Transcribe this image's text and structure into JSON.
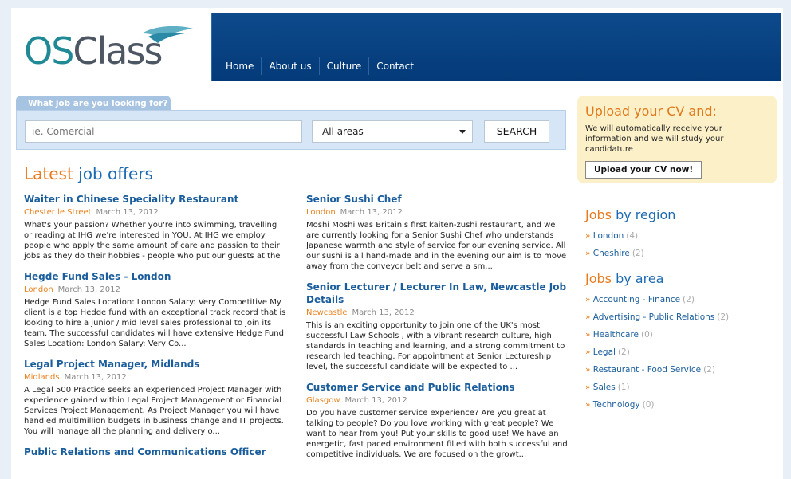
{
  "logo": {
    "text_a": "OS",
    "text_b": "Class"
  },
  "nav": [
    "Home",
    "About us",
    "Culture",
    "Contact"
  ],
  "search": {
    "tab_label": "What job are you looking for?",
    "placeholder": "ie. Comercial",
    "area_selected": "All areas",
    "button": "SEARCH"
  },
  "latest": {
    "word1": "Latest",
    "word2": "job offers"
  },
  "jobs_left": [
    {
      "title": "Waiter in Chinese Speciality Restaurant",
      "location": "Chester le Street",
      "date": "March 13, 2012",
      "desc": "What's your passion? Whether you're into swimming, travelling or reading at IHG we're interested in YOU. At IHG we employ people who apply the same amount of care and passion to their jobs as they do their hobbies - people who put our guests at the"
    },
    {
      "title": "Hegde Fund Sales - London",
      "location": "London",
      "date": "March 13, 2012",
      "desc": "Hedge Fund Sales Location: London Salary: Very Competitive My client is a top Hedge fund with an exceptional track record that is looking to hire a junior / mid level sales professional to join its team. The successful candidates will have extensive Hedge Fund Sales Location: London Salary: Very Co..."
    },
    {
      "title": "Legal Project Manager, Midlands",
      "location": "Midlands",
      "date": "March 13, 2012",
      "desc": "A Legal 500 Practice seeks an experienced Project Manager with experience gained within Legal Project Management or Financial Services Project Management. As Project Manager you will have handled multimillion budgets in business change and IT projects. You will manage all the planning and delivery o..."
    },
    {
      "title": "Public Relations and Communications Officer",
      "location": "",
      "date": "",
      "desc": ""
    }
  ],
  "jobs_right": [
    {
      "title": "Senior Sushi Chef",
      "location": "London",
      "date": "March 13, 2012",
      "desc": "Moshi Moshi was Britain's first kaiten-zushi restaurant, and we are currently looking for a Senior Sushi Chef who understands Japanese warmth and style of service for our evening service. All our sushi is all hand-made and in the evening our aim is to move away from the conveyor belt and serve a sm..."
    },
    {
      "title": "Senior Lecturer / Lecturer In Law, Newcastle Job Details",
      "location": "Newcastle",
      "date": "March 13, 2012",
      "desc": "This is an exciting opportunity to join one of the UK's most successful Law Schools , with a vibrant research culture, high standards in teaching and learning, and a strong commitment to research led teaching. For appointment at Senior Lectureship level, the successful candidate will be expected to ..."
    },
    {
      "title": "Customer Service and Public Relations",
      "location": "Glasgow",
      "date": "March 13, 2012",
      "desc": "Do you have customer service experience? Are you great at talking to people? Do you love working with great people? We want to hear from you! Put your skills to good use! We have an energetic, fast paced environment filled with both successful and competitive individuals. We are focused on the growt..."
    }
  ],
  "cv": {
    "heading": "Upload your CV and:",
    "text": "We will automatically receive your information and we will study your candidature",
    "button": "Upload your CV now!"
  },
  "by_region": {
    "word1": "Jobs",
    "word2": "by region",
    "items": [
      {
        "label": "London",
        "count": "(4)"
      },
      {
        "label": "Cheshire",
        "count": "(2)"
      }
    ]
  },
  "by_area": {
    "word1": "Jobs",
    "word2": "by area",
    "items": [
      {
        "label": "Accounting - Finance",
        "count": "(2)"
      },
      {
        "label": "Advertising - Public Relations",
        "count": "(2)"
      },
      {
        "label": "Healthcare",
        "count": "(0)"
      },
      {
        "label": "Legal",
        "count": "(2)"
      },
      {
        "label": "Restaurant - Food Service",
        "count": "(2)"
      },
      {
        "label": "Sales",
        "count": "(1)"
      },
      {
        "label": "Technology",
        "count": "(0)"
      }
    ]
  },
  "arrow_glyph": "»"
}
